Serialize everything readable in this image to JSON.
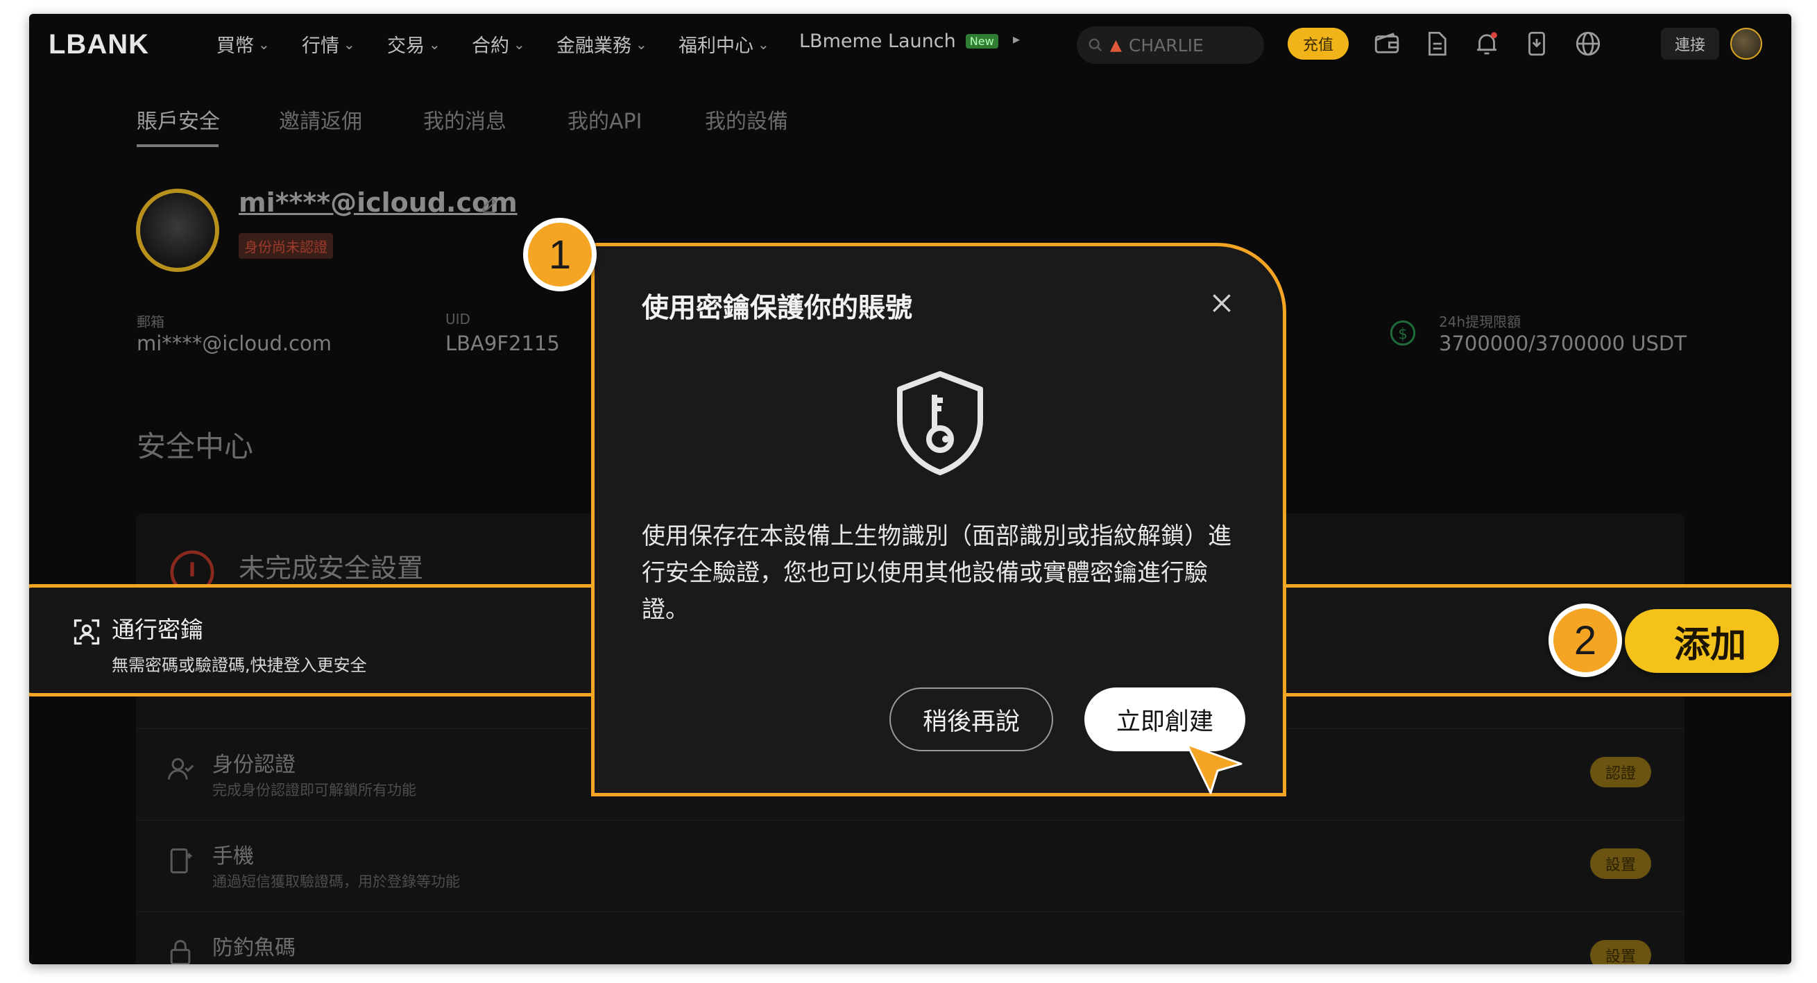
{
  "brand": {
    "logo": "LBANK",
    "accent": "#f5a524",
    "button_yellow": "#f5c21c"
  },
  "topnav": {
    "items": [
      {
        "label": "買幣",
        "chevron": "⌄"
      },
      {
        "label": "行情",
        "chevron": "⌄"
      },
      {
        "label": "交易",
        "chevron": "⌄"
      },
      {
        "label": "合約",
        "chevron": "⌄"
      },
      {
        "label": "金融業務",
        "chevron": "⌄"
      },
      {
        "label": "福利中心",
        "chevron": "⌄"
      },
      {
        "label": "LBmeme Launch",
        "badge": "New"
      }
    ],
    "more": "▸",
    "search_value": "CHARLIE",
    "deposit": "充值",
    "connect": "連接",
    "icons": [
      "wallet-icon",
      "document-icon",
      "bell-icon",
      "download-icon",
      "globe-icon"
    ]
  },
  "tabs": [
    {
      "label": "賬戶安全",
      "active": true
    },
    {
      "label": "邀請返佣"
    },
    {
      "label": "我的消息"
    },
    {
      "label": "我的API"
    },
    {
      "label": "我的設備"
    }
  ],
  "profile": {
    "email": "mi****@icloud.com",
    "kyc_status": "身份尚未認證",
    "fields": [
      {
        "label": "郵箱",
        "value": "mi****@icloud.com"
      },
      {
        "label": "UID",
        "value": "LBA9F2115"
      },
      {
        "label": "24h提現限額",
        "value": "3700000/3700000 USDT"
      }
    ]
  },
  "security": {
    "heading": "安全中心",
    "incomplete": "未完成安全設置",
    "passkey": {
      "title": "通行密鑰",
      "desc": "無需密碼或驗證碼,快捷登入更安全",
      "add": "添加"
    },
    "rows": [
      {
        "title": "身份認證",
        "desc": "完成身份認證即可解鎖所有功能",
        "button": "認證"
      },
      {
        "title": "手機",
        "desc": "通過短信獲取驗證碼，用於登錄等功能",
        "button": "設置"
      },
      {
        "title": "防釣魚碼",
        "desc": "",
        "button": "設置"
      }
    ]
  },
  "modal": {
    "title": "使用密鑰保護你的賬號",
    "body": "使用保存在本設備上生物識別（面部識別或指紋解鎖）進行安全驗證，您也可以使用其他設備或實體密鑰進行驗證。",
    "later": "稍後再說",
    "create": "立即創建"
  },
  "steps": [
    "1",
    "2"
  ]
}
